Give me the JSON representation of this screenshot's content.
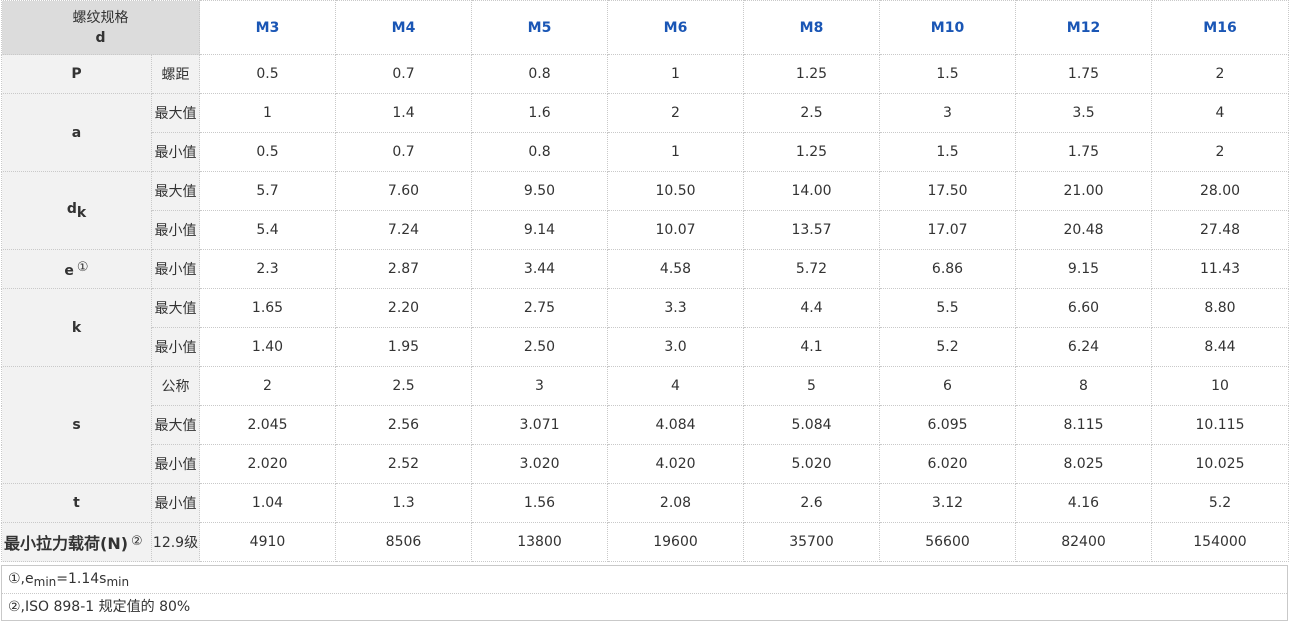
{
  "header": {
    "corner_line1": "螺纹规格",
    "corner_line2": "d",
    "columns": [
      "M3",
      "M4",
      "M5",
      "M6",
      "M8",
      "M10",
      "M12",
      "M16"
    ]
  },
  "params": {
    "P": {
      "symbol": "P"
    },
    "a": {
      "symbol": "a"
    },
    "dk": {
      "symbol": "d",
      "subscript": "k"
    },
    "e": {
      "symbol": "e",
      "note_mark": "①"
    },
    "k": {
      "symbol": "k"
    },
    "s": {
      "symbol": "s"
    },
    "t": {
      "symbol": "t"
    },
    "load": {
      "label": "最小拉力载荷(N)",
      "note_mark": "②"
    }
  },
  "rows": [
    {
      "label": "螺距",
      "values": [
        "0.5",
        "0.7",
        "0.8",
        "1",
        "1.25",
        "1.5",
        "1.75",
        "2"
      ]
    },
    {
      "label": "最大值",
      "values": [
        "1",
        "1.4",
        "1.6",
        "2",
        "2.5",
        "3",
        "3.5",
        "4"
      ]
    },
    {
      "label": "最小值",
      "values": [
        "0.5",
        "0.7",
        "0.8",
        "1",
        "1.25",
        "1.5",
        "1.75",
        "2"
      ]
    },
    {
      "label": "最大值",
      "values": [
        "5.7",
        "7.60",
        "9.50",
        "10.50",
        "14.00",
        "17.50",
        "21.00",
        "28.00"
      ]
    },
    {
      "label": "最小值",
      "values": [
        "5.4",
        "7.24",
        "9.14",
        "10.07",
        "13.57",
        "17.07",
        "20.48",
        "27.48"
      ]
    },
    {
      "label": "最小值",
      "values": [
        "2.3",
        "2.87",
        "3.44",
        "4.58",
        "5.72",
        "6.86",
        "9.15",
        "11.43"
      ]
    },
    {
      "label": "最大值",
      "values": [
        "1.65",
        "2.20",
        "2.75",
        "3.3",
        "4.4",
        "5.5",
        "6.60",
        "8.80"
      ]
    },
    {
      "label": "最小值",
      "values": [
        "1.40",
        "1.95",
        "2.50",
        "3.0",
        "4.1",
        "5.2",
        "6.24",
        "8.44"
      ]
    },
    {
      "label": "公称",
      "values": [
        "2",
        "2.5",
        "3",
        "4",
        "5",
        "6",
        "8",
        "10"
      ]
    },
    {
      "label": "最大值",
      "values": [
        "2.045",
        "2.56",
        "3.071",
        "4.084",
        "5.084",
        "6.095",
        "8.115",
        "10.115"
      ]
    },
    {
      "label": "最小值",
      "values": [
        "2.020",
        "2.52",
        "3.020",
        "4.020",
        "5.020",
        "6.020",
        "8.025",
        "10.025"
      ]
    },
    {
      "label": "最小值",
      "values": [
        "1.04",
        "1.3",
        "1.56",
        "2.08",
        "2.6",
        "3.12",
        "4.16",
        "5.2"
      ]
    },
    {
      "label": "12.9级",
      "values": [
        "4910",
        "8506",
        "13800",
        "19600",
        "35700",
        "56600",
        "82400",
        "154000"
      ]
    }
  ],
  "notes": {
    "note1": {
      "prefix": "①,e",
      "sub1": "min",
      "middle": "=1.14s",
      "sub2": "min"
    },
    "note2": {
      "text": "②,ISO 898-1 规定值的 80%"
    }
  },
  "colors": {
    "header_text": "#1a56b5",
    "corner_bg": "#dcdcdc",
    "label_bg": "#f2f2f2",
    "border": "#c9c9c9"
  }
}
